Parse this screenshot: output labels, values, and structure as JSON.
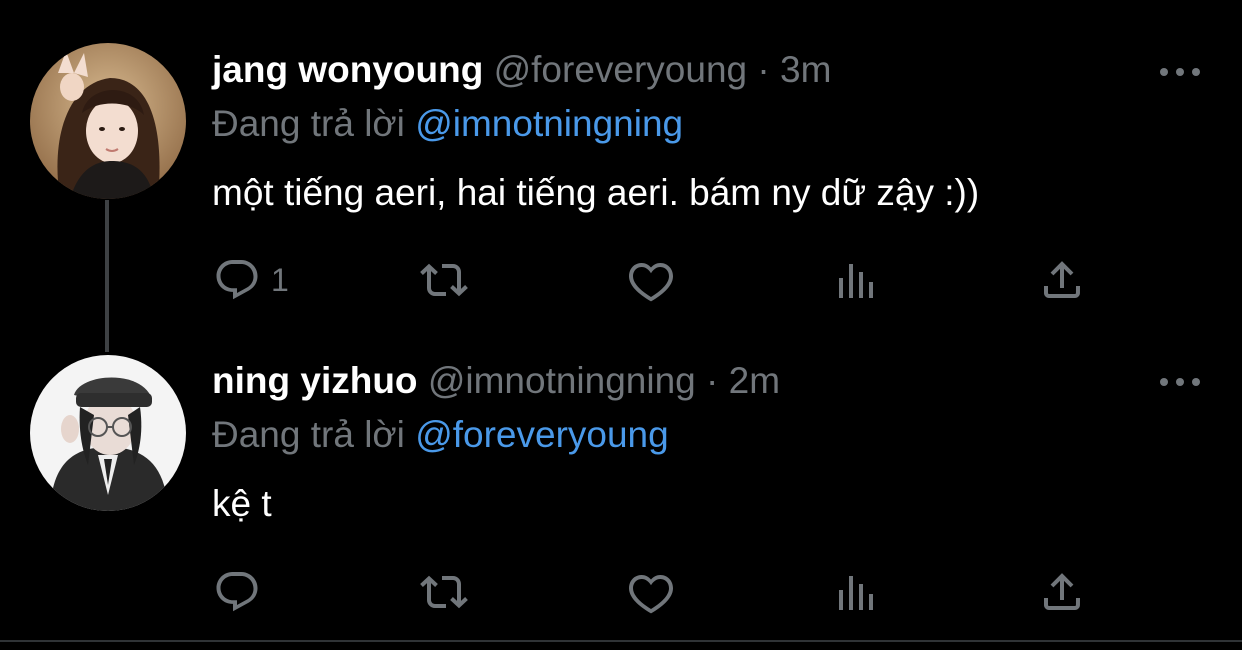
{
  "colors": {
    "background": "#000000",
    "name": "#ffffff",
    "muted": "#71767b",
    "mention": "#4a99e9",
    "thread_line": "#3e4144"
  },
  "tweets": [
    {
      "name": "jang wonyoung",
      "handle": "@foreveryoung",
      "sep": "·",
      "time": "3m",
      "reply_prefix": "Đang trả lời",
      "reply_to": "@imnotningning",
      "text": "một tiếng aeri, hai tiếng aeri. bám ny dữ zậy :))",
      "reply_count": "1",
      "icons": [
        "reply-icon",
        "retweet-icon",
        "like-icon",
        "views-icon",
        "share-icon",
        "more-icon"
      ]
    },
    {
      "name": "ning yizhuo",
      "handle": "@imnotningning",
      "sep": "·",
      "time": "2m",
      "reply_prefix": "Đang trả lời",
      "reply_to": "@foreveryoung",
      "text": "kệ t",
      "reply_count": "",
      "icons": [
        "reply-icon",
        "retweet-icon",
        "like-icon",
        "views-icon",
        "share-icon",
        "more-icon"
      ]
    }
  ]
}
